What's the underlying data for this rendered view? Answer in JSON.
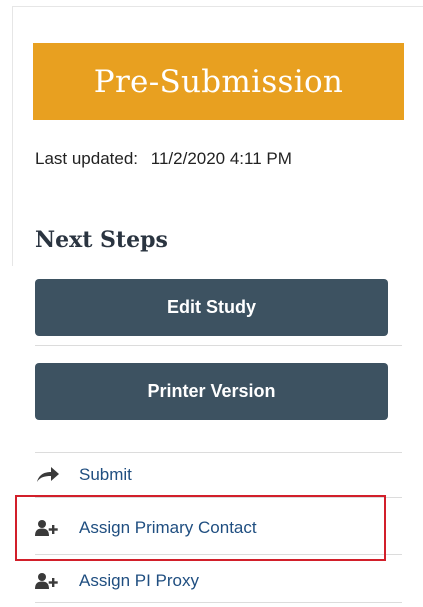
{
  "status": {
    "label": "Pre-Submission",
    "color": "#e8a020"
  },
  "last_updated": {
    "label": "Last updated:",
    "value": "11/2/2020 4:11 PM"
  },
  "next_steps": {
    "heading": "Next Steps",
    "buttons": [
      {
        "label": "Edit Study",
        "icon": null
      },
      {
        "label": "Printer Version",
        "icon": null
      }
    ],
    "links": [
      {
        "label": "Submit",
        "icon": "share-arrow-icon"
      },
      {
        "label": "Assign Primary Contact",
        "icon": "add-user-icon",
        "highlighted": true
      },
      {
        "label": "Assign PI Proxy",
        "icon": "add-user-icon"
      }
    ]
  },
  "colors": {
    "button_bg": "#3d5261",
    "link_text": "#1f4e80",
    "highlight": "#d21f2a",
    "icon": "#3a3a3a"
  }
}
